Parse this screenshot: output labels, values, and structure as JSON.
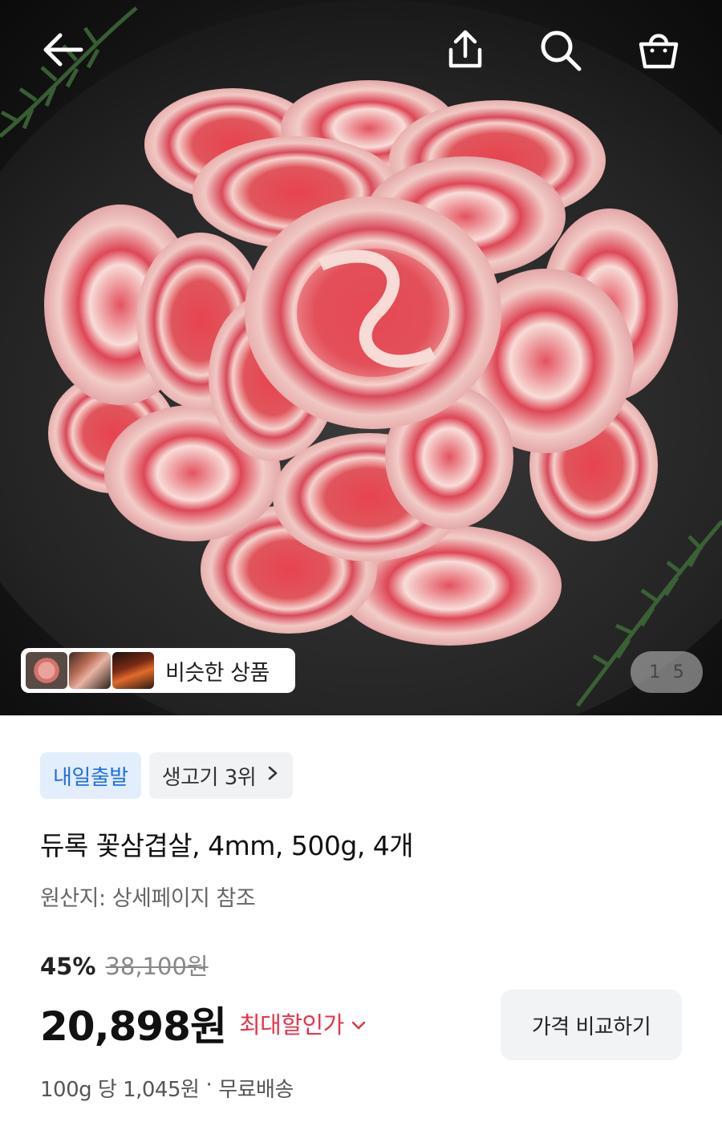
{
  "nav": {
    "back_icon": "arrow-left-icon",
    "share_icon": "share-icon",
    "search_icon": "search-icon",
    "cart_icon": "shopping-bag-icon"
  },
  "gallery": {
    "similar_label": "비슷한 상품",
    "page_current": "1",
    "page_separator": "|",
    "page_total": "5"
  },
  "badges": {
    "delivery": "내일출발",
    "rank": "생고기 3위",
    "rank_icon": "chevron-right-icon"
  },
  "product": {
    "title": "듀록 꽃삼겹살, 4mm, 500g, 4개",
    "origin": "원산지: 상세페이지 참조"
  },
  "pricing": {
    "discount": "45%",
    "original_price": "38,100원",
    "price": "20,898원",
    "max_discount_label": "최대할인가",
    "compare_button": "가격 비교하기",
    "unit_price": "100g 당 1,045원",
    "separator": "·",
    "shipping": "무료배송"
  },
  "colors": {
    "accent_red": "#e8334a",
    "badge_blue": "#1d6fe5",
    "badge_blue_bg": "#e3eefc"
  }
}
